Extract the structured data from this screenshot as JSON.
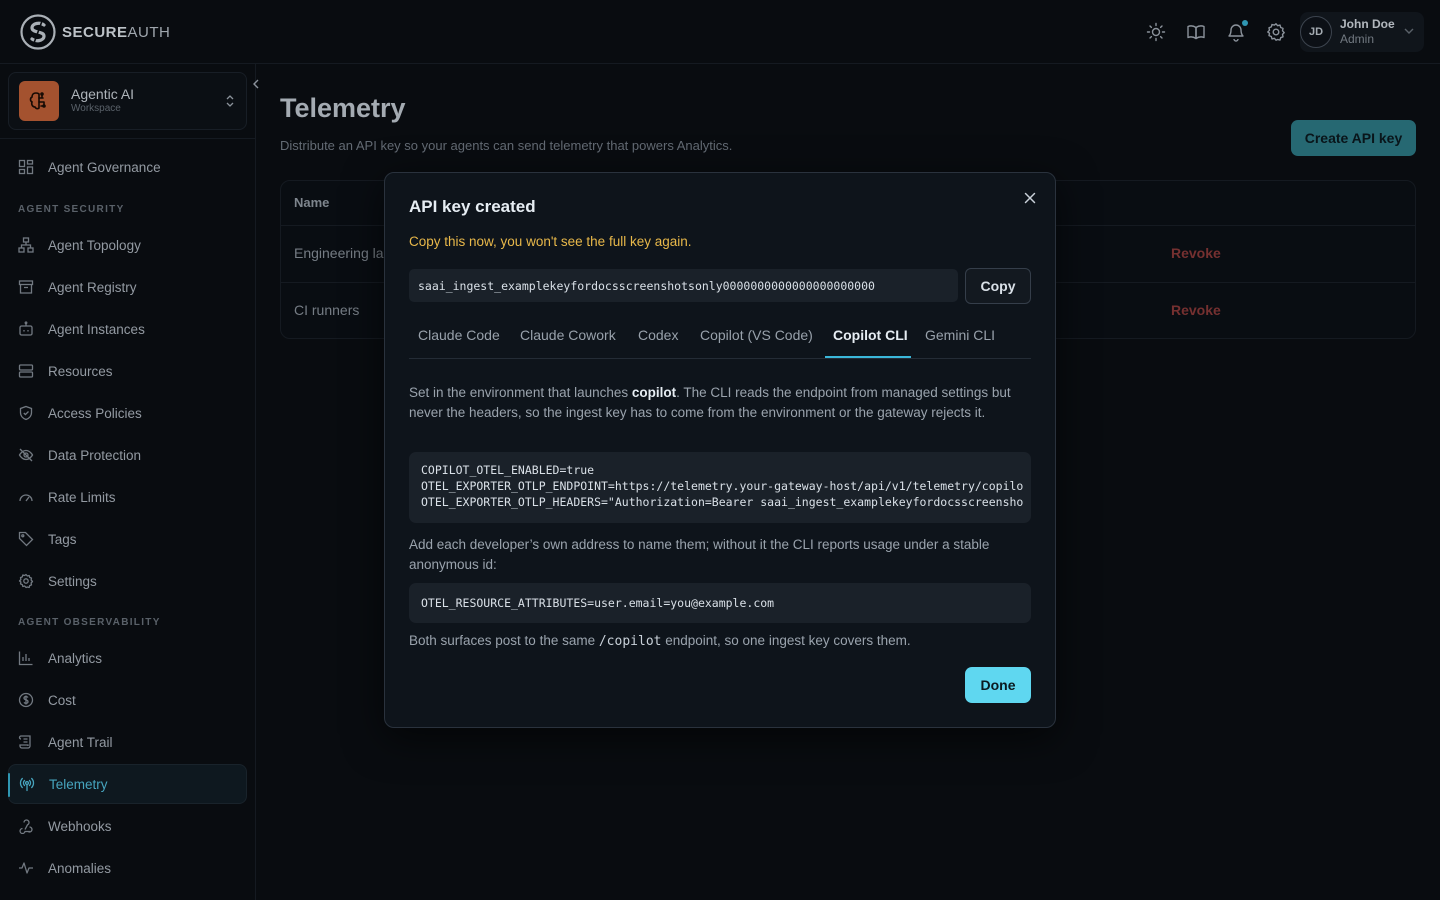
{
  "brand": {
    "bold": "SECURE",
    "light": "AUTH"
  },
  "topbar": {
    "icons": [
      "sun-icon",
      "book-icon",
      "bell-icon",
      "gear-icon"
    ],
    "user": {
      "initials": "JD",
      "name": "John Doe",
      "role": "Admin"
    }
  },
  "workspace": {
    "name": "Agentic AI",
    "subtitle": "Workspace"
  },
  "sidebar": {
    "top_item": "Agent Governance",
    "section_security": "AGENT SECURITY",
    "security_items": [
      "Agent Topology",
      "Agent Registry",
      "Agent Instances",
      "Resources",
      "Access Policies",
      "Data Protection",
      "Rate Limits",
      "Tags",
      "Settings"
    ],
    "section_observability": "AGENT OBSERVABILITY",
    "observability_items": [
      "Analytics",
      "Cost",
      "Agent Trail",
      "Telemetry",
      "Webhooks",
      "Anomalies"
    ],
    "active": "Telemetry"
  },
  "page": {
    "title": "Telemetry",
    "subtitle": "Distribute an API key so your agents can send telemetry that powers Analytics.",
    "create_button": "Create API key"
  },
  "table": {
    "header_name": "Name",
    "rows": [
      {
        "name": "Engineering laptops",
        "action": "Revoke"
      },
      {
        "name": "CI runners",
        "action": "Revoke"
      }
    ]
  },
  "modal": {
    "title": "API key created",
    "warning": "Copy this now, you won't see the full key again.",
    "api_key": "saai_ingest_examplekeyfordocsscreenshotsonly0000000000000000000000",
    "copy_button": "Copy",
    "tabs": [
      "Claude Code",
      "Claude Cowork",
      "Codex",
      "Copilot (VS Code)",
      "Copilot CLI",
      "Gemini CLI"
    ],
    "active_tab": "Copilot CLI",
    "intro_before": "Set in the environment that launches ",
    "intro_command": "copilot",
    "intro_after": ". The CLI reads the endpoint from managed settings but never the headers, so the ingest key has to come from the environment or the gateway rejects it.",
    "env_block": "COPILOT_OTEL_ENABLED=true\nOTEL_EXPORTER_OTLP_ENDPOINT=https://telemetry.your-gateway-host/api/v1/telemetry/copilo\nOTEL_EXPORTER_OTLP_HEADERS=\"Authorization=Bearer saai_ingest_examplekeyfordocsscreensho",
    "identity_text": "Add each developer’s own address to name them; without it the CLI reports usage under a stable anonymous id:",
    "identity_block": "OTEL_RESOURCE_ATTRIBUTES=user.email=you@example.com",
    "footer_before": "Both surfaces post to the same ",
    "footer_path": "/copilot",
    "footer_after": " endpoint, so one ingest key covers them.",
    "done_button": "Done"
  },
  "colors": {
    "accent": "#3ab7d9",
    "warning": "#e8b84a",
    "danger": "#8f3b3b",
    "workspace_logo": "#c8643a"
  }
}
